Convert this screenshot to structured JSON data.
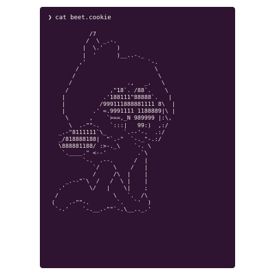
{
  "terminal": {
    "background_color": "#2e1430",
    "text_color": "#e8e1de",
    "prompt_symbol": "❯",
    "command": "cat beet.cookie",
    "output_lines": [
      "            /7",
      "           /  \\ _.-.",
      "          |  \\.'    )",
      "          |  '      )__..-._",
      "         ,'                  `-.",
      "        /                      \\",
      "       /                        \\",
      "      /                .,   _.   \\",
      "     /            ,\"18`. /88`.    \\",
      "    |           .'188111\"88888`.   |",
      "    |          /999111888881111 8\\  |",
      "    |        .' =.9991111 1188889|\\ |",
      "     \\      ,    `>==,_N 989999 |:\\,",
      "      \\  .-\"\"-.   `:::|   99:)  ,:/",
      "   _.-\"8111111`\\_     `.--'-.  .:/",
      "   _/818888188|  \"`.-\"  `-._\"-.:/",
      "   \\888881188/ :>-._\\    `-. \\",
      "    `.____.\" <--'         .`\\",
      "          `-.  .--.      /  |",
      "             `/    \\    /   |",
      "             /     /\\  |    |",
      "     _.--\"`\\  /   /  \\ |    |",
      "   .'       \\/   |    \\|    ;",
      "  /                \\   `.  /\\",
      " (    .-\"\"-.        `.   `'  )",
      "  `-.'    `-.__.-\"\"`-.\\__.._.'"
    ]
  }
}
